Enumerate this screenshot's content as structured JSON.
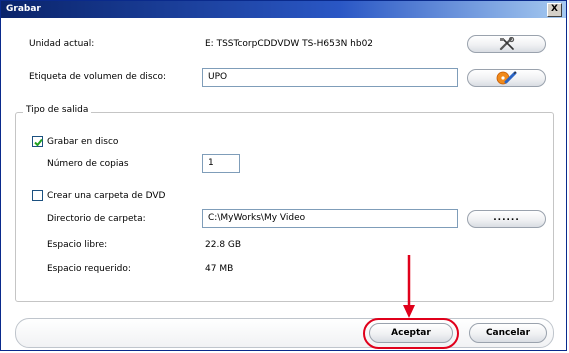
{
  "window": {
    "title": "Grabar",
    "close_label": "X"
  },
  "fields": {
    "unidad_label": "Unidad actual:",
    "unidad_value": "E: TSSTcorpCDDVDW TS-H653N hb02",
    "etiqueta_label": "Etiqueta de volumen de disco:",
    "etiqueta_value": "UPO"
  },
  "output": {
    "legend": "Tipo de salida",
    "grabar_disco_label": "Grabar en disco",
    "grabar_disco_checked": true,
    "copias_label": "Número de copias",
    "copias_value": "1",
    "carpeta_dvd_label": "Crear una carpeta de DVD",
    "carpeta_dvd_checked": false,
    "directorio_label": "Directorio de carpeta:",
    "directorio_value": "C:\\MyWorks\\My Video",
    "browse_label": "......",
    "espacio_libre_label": "Espacio libre:",
    "espacio_libre_value": "22.8 GB",
    "espacio_requerido_label": "Espacio requerido:",
    "espacio_requerido_value": "47 MB"
  },
  "buttons": {
    "aceptar": "Aceptar",
    "cancelar": "Cancelar"
  },
  "icons": {
    "settings": "tools-icon",
    "label_edit": "disc-edit-icon"
  },
  "colors": {
    "highlight": "#e0001b",
    "titlebar": "#0a246a"
  }
}
